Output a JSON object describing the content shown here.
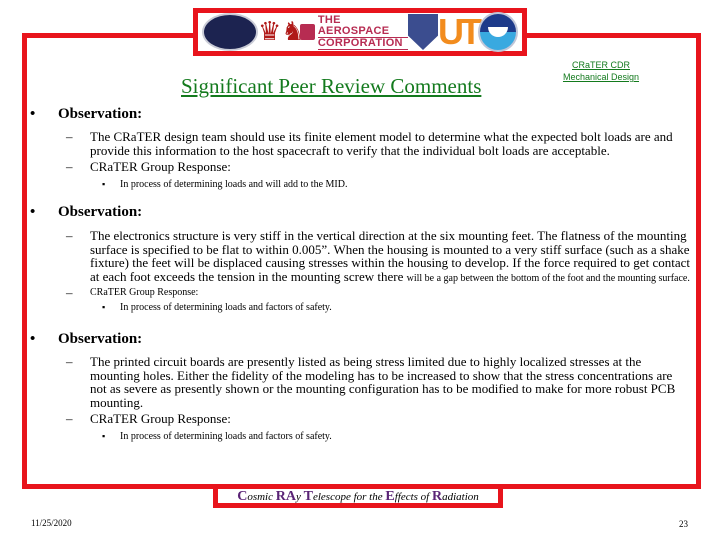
{
  "header": {
    "logos": [
      {
        "name": "nasa-lro-logo-icon"
      },
      {
        "name": "boston-university-logo-icon"
      },
      {
        "name": "aerospace-corporation-logo-icon",
        "text_lines": [
          "THE AEROSPACE",
          "CORPORATION"
        ]
      },
      {
        "name": "air-force-shield-logo-icon"
      },
      {
        "name": "ut-logo-icon",
        "text": "UT"
      },
      {
        "name": "noaa-logo-icon"
      }
    ],
    "title": "Significant Peer Review Comments",
    "subtitle_line1": "CRaTER CDR",
    "subtitle_line2": "Mechanical Design"
  },
  "observations": [
    {
      "label": "Observation:",
      "items": [
        {
          "text": "The CRaTER design team should use its finite element model to determine what the expected bolt loads are and provide this information to the host spacecraft to verify that the individual bolt loads are acceptable."
        },
        {
          "text": "CRaTER Group Response:",
          "subitems": [
            "In process of determining loads and will add to the MID."
          ]
        }
      ]
    },
    {
      "label": "Observation:",
      "items": [
        {
          "text": "The electronics structure is very stiff in the vertical direction at the six mounting feet.  The flatness of the mounting surface is specified to be flat to within 0.005”.  When the housing is mounted to a very stiff surface (such as a shake fixture) the feet will be displaced causing stresses within the housing to develop.  If the force required to get contact at each foot exceeds the tension in the mounting screw there",
          "small_tail": "will be a gap between the bottom of the foot and the mounting surface."
        },
        {
          "text": "CRaTER Group Response:",
          "subitems": [
            "In process of determining loads and factors of safety."
          ]
        }
      ]
    },
    {
      "label": "Observation:",
      "items": [
        {
          "text": "The printed circuit boards are presently listed as being stress limited due to highly localized stresses at the mounting holes. Either the fidelity of the modeling has to be increased to show that the stress concentrations are not as severe as presently shown or the mounting configuration has to be modified to make for more robust PCB mounting."
        },
        {
          "text": "CRaTER Group Response:",
          "subitems": [
            "In process of determining loads and factors of safety."
          ]
        }
      ]
    }
  ],
  "footer": {
    "banner": [
      {
        "cap": "C",
        "rest": "osmic "
      },
      {
        "cap": "RA",
        "rest": "y "
      },
      {
        "cap": "T",
        "rest": "elescope for the "
      },
      {
        "cap": "E",
        "rest": "ffects of "
      },
      {
        "cap": "R",
        "rest": "adiation"
      }
    ],
    "date": "11/25/2020",
    "page_number": "23"
  },
  "colors": {
    "frame_red": "#e8141c",
    "title_green": "#137a1d",
    "banner_purple": "#5a2376"
  }
}
